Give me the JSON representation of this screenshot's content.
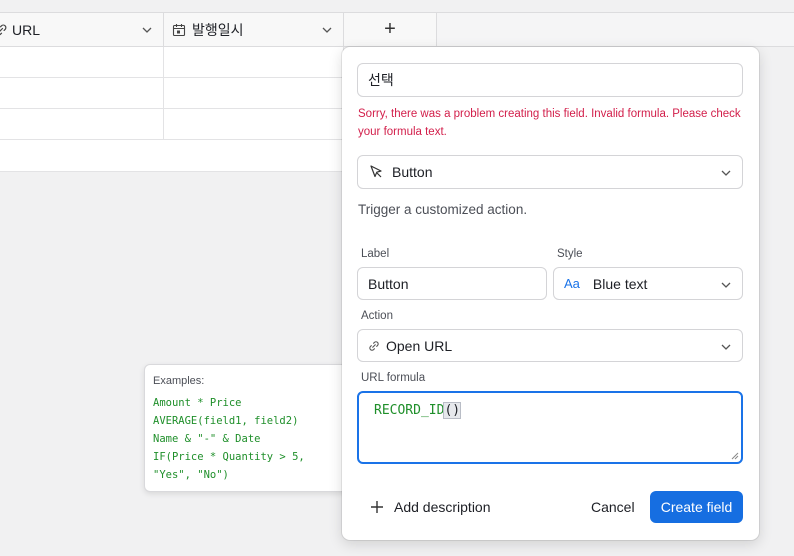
{
  "grid": {
    "columns": [
      {
        "label": "URL",
        "icon": "link-icon"
      },
      {
        "label": "발행일시",
        "icon": "calendar-icon"
      }
    ],
    "add_column_symbol": "+"
  },
  "panel": {
    "field_name": "선택",
    "error": "Sorry, there was a problem creating this field. Invalid formula. Please check your formula text.",
    "field_type": "Button",
    "field_type_description": "Trigger a customized action.",
    "label_caption": "Label",
    "label_value": "Button",
    "style_caption": "Style",
    "style_icon_text": "Aa",
    "style_value": "Blue text",
    "action_caption": "Action",
    "action_value": "Open URL",
    "url_formula_caption": "URL formula",
    "formula_text": "RECORD_ID",
    "formula_parens": "()",
    "add_description": "Add description",
    "cancel": "Cancel",
    "create": "Create field"
  },
  "examples": {
    "title": "Examples:",
    "lines": [
      "Amount * Price",
      "AVERAGE(field1, field2)",
      "Name & \"-\" & Date",
      "IF(Price * Quantity > 5,",
      "\"Yes\", \"No\")"
    ]
  },
  "colors": {
    "accent": "#166ee1",
    "error": "#d21e4a",
    "formula_code": "#1f8f2a"
  }
}
